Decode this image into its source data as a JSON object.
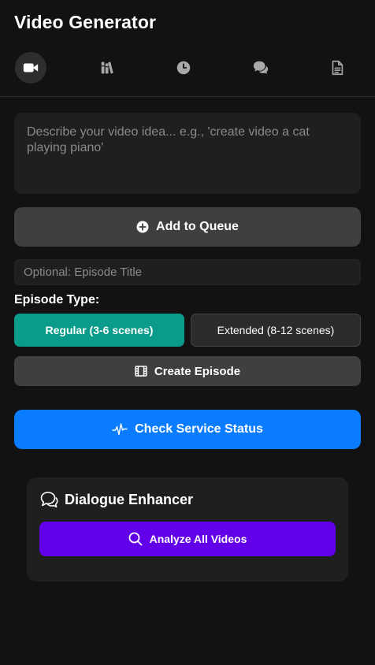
{
  "app": {
    "title": "Video Generator"
  },
  "tabs": [
    {
      "icon": "video-camera-icon",
      "active": true
    },
    {
      "icon": "library-icon",
      "active": false
    },
    {
      "icon": "clock-icon",
      "active": false
    },
    {
      "icon": "chat-bubbles-icon",
      "active": false
    },
    {
      "icon": "document-icon",
      "active": false
    }
  ],
  "prompt": {
    "placeholder": "Describe your video idea... e.g., 'create video a cat playing piano'",
    "value": ""
  },
  "queue_button": {
    "label": "Add to Queue",
    "icon": "plus-circle-icon"
  },
  "episode": {
    "title_placeholder": "Optional: Episode Title",
    "type_label": "Episode Type:",
    "types": [
      {
        "label": "Regular (3-6 scenes)",
        "selected": true
      },
      {
        "label": "Extended (8-12 scenes)",
        "selected": false
      }
    ],
    "create_label": "Create Episode",
    "create_icon": "film-icon"
  },
  "status_button": {
    "label": "Check Service Status",
    "icon": "pulse-icon"
  },
  "dialogue": {
    "title": "Dialogue Enhancer",
    "icon": "chat-bubble-icon",
    "analyze_label": "Analyze All Videos",
    "analyze_icon": "search-icon"
  },
  "colors": {
    "background": "#121212",
    "surface": "#1f1f1f",
    "regular_teal": "#0a9b8a",
    "status_blue": "#0a7cff",
    "analyze_purple": "#6200ea"
  }
}
